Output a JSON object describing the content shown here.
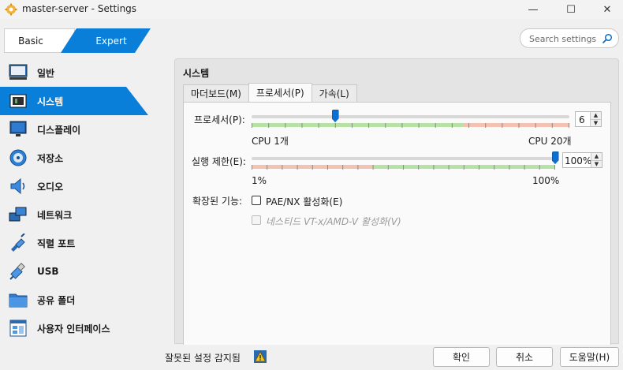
{
  "window": {
    "title": "master-server - Settings",
    "minimize_glyph": "—",
    "maximize_glyph": "☐",
    "close_glyph": "✕"
  },
  "mode": {
    "basic_label": "Basic",
    "expert_label": "Expert",
    "selected": "Expert"
  },
  "search": {
    "placeholder": "Search settings",
    "icon": "search-icon"
  },
  "sidebar": {
    "items": [
      {
        "label": "일반",
        "icon": "monitor-icon"
      },
      {
        "label": "시스템",
        "icon": "chip-icon",
        "selected": true
      },
      {
        "label": "디스플레이",
        "icon": "display-icon"
      },
      {
        "label": "저장소",
        "icon": "disk-icon"
      },
      {
        "label": "오디오",
        "icon": "speaker-icon"
      },
      {
        "label": "네트워크",
        "icon": "network-icon"
      },
      {
        "label": "직렬 포트",
        "icon": "serial-port-icon"
      },
      {
        "label": "USB",
        "icon": "usb-icon"
      },
      {
        "label": "공유 폴더",
        "icon": "folder-icon"
      },
      {
        "label": "사용자 인터페이스",
        "icon": "ui-icon"
      }
    ]
  },
  "panel": {
    "title": "시스템",
    "tabs": [
      {
        "label": "마더보드(M)"
      },
      {
        "label": "프로세서(P)",
        "active": true
      },
      {
        "label": "가속(L)"
      }
    ],
    "processor": {
      "label": "프로세서(P):",
      "value": "6",
      "min_label": "CPU 1개",
      "max_label": "CPU 20개",
      "min": 1,
      "max": 20,
      "current": 6
    },
    "execution_cap": {
      "label": "실행 제한(E):",
      "value": "100%",
      "min_label": "1%",
      "max_label": "100%",
      "current_percent": 100
    },
    "extended_features": {
      "label": "확장된 기능:",
      "pae_label": "PAE/NX 활성화(E)",
      "pae_checked": false,
      "nested_label": "네스티드 VT-x/AMD-V 활성화(V)",
      "nested_checked": false,
      "nested_enabled": false
    }
  },
  "footer": {
    "warning_text": "잘못된 설정 감지됨",
    "ok_label": "확인",
    "cancel_label": "취소",
    "help_label": "도움말(H)"
  },
  "colors": {
    "accent": "#0a7fd9",
    "band_green": "#b7e2a6",
    "band_red": "#f4c2b0"
  }
}
